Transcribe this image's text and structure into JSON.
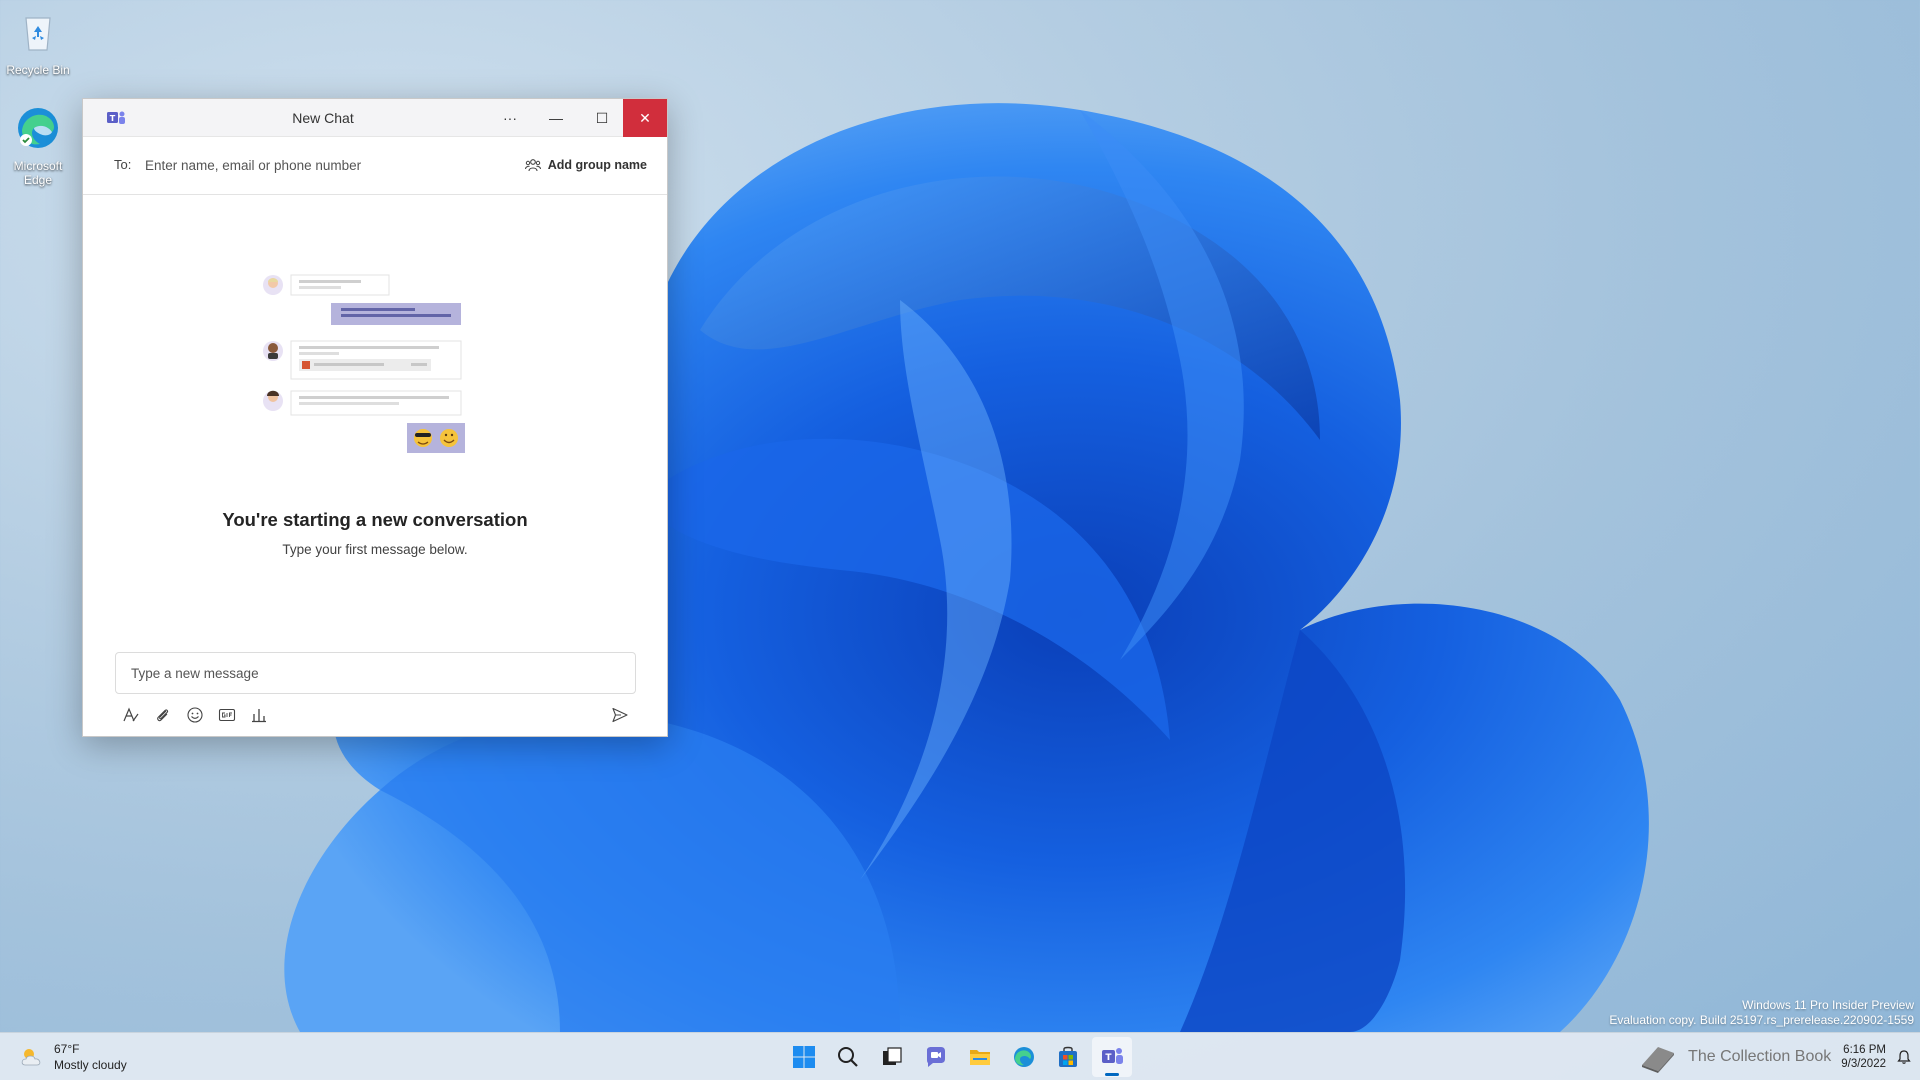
{
  "desktop": {
    "icons": [
      {
        "label": "Recycle Bin",
        "icon": "recycle-bin-icon"
      },
      {
        "label": "Microsoft Edge",
        "icon": "edge-icon"
      }
    ]
  },
  "window": {
    "title": "New Chat",
    "app_icon": "teams-icon",
    "controls": {
      "more": "···",
      "minimize": "—",
      "maximize": "☐",
      "close": "✕"
    },
    "to": {
      "label": "To:",
      "placeholder": "Enter name, email or phone number"
    },
    "add_group_label": "Add group name",
    "empty_state": {
      "heading": "You're starting a new conversation",
      "subheading": "Type your first message below."
    },
    "compose": {
      "placeholder": "Type a new message"
    },
    "tools": [
      "format-icon",
      "attach-icon",
      "emoji-icon",
      "gif-icon",
      "poll-icon"
    ],
    "send_icon": "send-icon"
  },
  "watermark": {
    "line1": "Windows 11 Pro Insider Preview",
    "line2": "Evaluation copy. Build 25197.rs_prerelease.220902-1559"
  },
  "taskbar": {
    "weather": {
      "temp": "67°F",
      "condition": "Mostly cloudy"
    },
    "apps": [
      "start-icon",
      "search-icon",
      "task-view-icon",
      "teams-chat-icon",
      "file-explorer-icon",
      "edge-icon",
      "store-icon",
      "teams-icon"
    ],
    "active_app": "teams-icon",
    "tray_text": "The Collection Book",
    "clock": {
      "time": "6:16 PM",
      "date": "9/3/2022"
    }
  },
  "colors": {
    "accent": "#0067c0",
    "close": "#d12e3c",
    "teams": "#5b5fc7",
    "bubble": "#b5b3dc"
  }
}
